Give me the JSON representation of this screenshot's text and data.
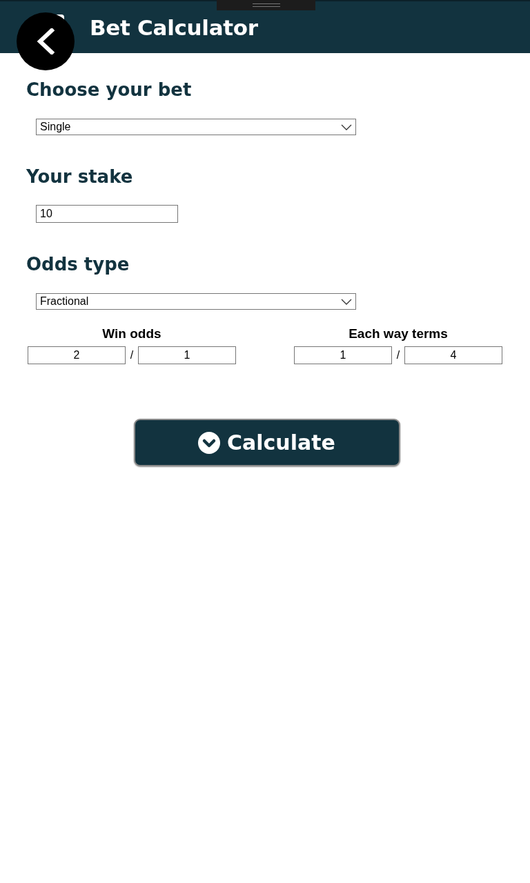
{
  "header": {
    "title": "Bet Calculator"
  },
  "sections": [
    {
      "heading": "Choose your bet",
      "kind": "select",
      "value": "Single"
    },
    {
      "heading": "Your stake",
      "kind": "input",
      "value": "10"
    },
    {
      "heading": "Odds type",
      "kind": "select",
      "value": "Fractional"
    }
  ],
  "odds_groups": [
    {
      "label": "Win odds",
      "numerator": "2",
      "separator": "/",
      "denominator": "1"
    },
    {
      "label": "Each way terms",
      "numerator": "1",
      "separator": "/",
      "denominator": "4"
    }
  ],
  "calculate_button": {
    "label": "Calculate"
  }
}
